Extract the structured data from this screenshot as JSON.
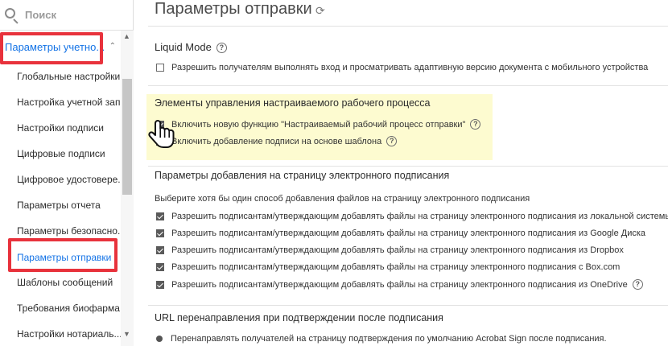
{
  "sidebar": {
    "search_placeholder": "Поиск",
    "section_label": "Параметры учетно...",
    "items": [
      {
        "label": "Глобальные настройки"
      },
      {
        "label": "Настройка учетной зап..."
      },
      {
        "label": "Настройки подписи"
      },
      {
        "label": "Цифровые подписи"
      },
      {
        "label": "Цифровое удостовере..."
      },
      {
        "label": "Параметры отчета"
      },
      {
        "label": "Параметры безопасно..."
      },
      {
        "label": "Параметры отправки"
      },
      {
        "label": "Шаблоны сообщений"
      },
      {
        "label": "Требования биофарма..."
      },
      {
        "label": "Настройки нотариаль..."
      }
    ],
    "active_item": "Параметры отправки"
  },
  "main": {
    "title": "Параметры отправки",
    "liquid_mode": {
      "title": "Liquid Mode",
      "option": "Разрешить получателям выполнять вход и просматривать адаптивную версию документа с мобильного устройства"
    },
    "workflow": {
      "title": "Элементы управления настраиваемого рабочего процесса",
      "option1": "Включить новую функцию \"Настраиваемый рабочий процесс отправки\"",
      "option2": "Включить добавление подписи на основе шаблона"
    },
    "add_files": {
      "title": "Параметры добавления на страницу электронного подписания",
      "note": "Выберите хотя бы один способ добавления файлов на страницу электронного подписания",
      "options": [
        "Разрешить подписантам/утверждающим добавлять файлы на страницу электронного подписания из локальной системы",
        "Разрешить подписантам/утверждающим добавлять файлы на страницу электронного подписания из Google Диска",
        "Разрешить подписантам/утверждающим добавлять файлы на страницу электронного подписания из Dropbox",
        "Разрешить подписантам/утверждающим добавлять файлы на страницу электронного подписания с Box.com",
        "Разрешить подписантам/утверждающим добавлять файлы на страницу электронного подписания из OneDrive"
      ]
    },
    "redirect": {
      "title": "URL перенаправления при подтверждении после подписания",
      "option": "Перенаправлять получателей на страницу подтверждения по умолчанию Acrobat Sign после подписания."
    },
    "help_glyph": "?"
  },
  "colors": {
    "accent": "#1473e6",
    "highlight_border": "#e8323c",
    "highlight_fill": "#fdfbd0"
  },
  "icons": {
    "search": "search-icon",
    "refresh": "refresh-icon",
    "help": "help-icon",
    "cursor": "hand-cursor-icon"
  }
}
